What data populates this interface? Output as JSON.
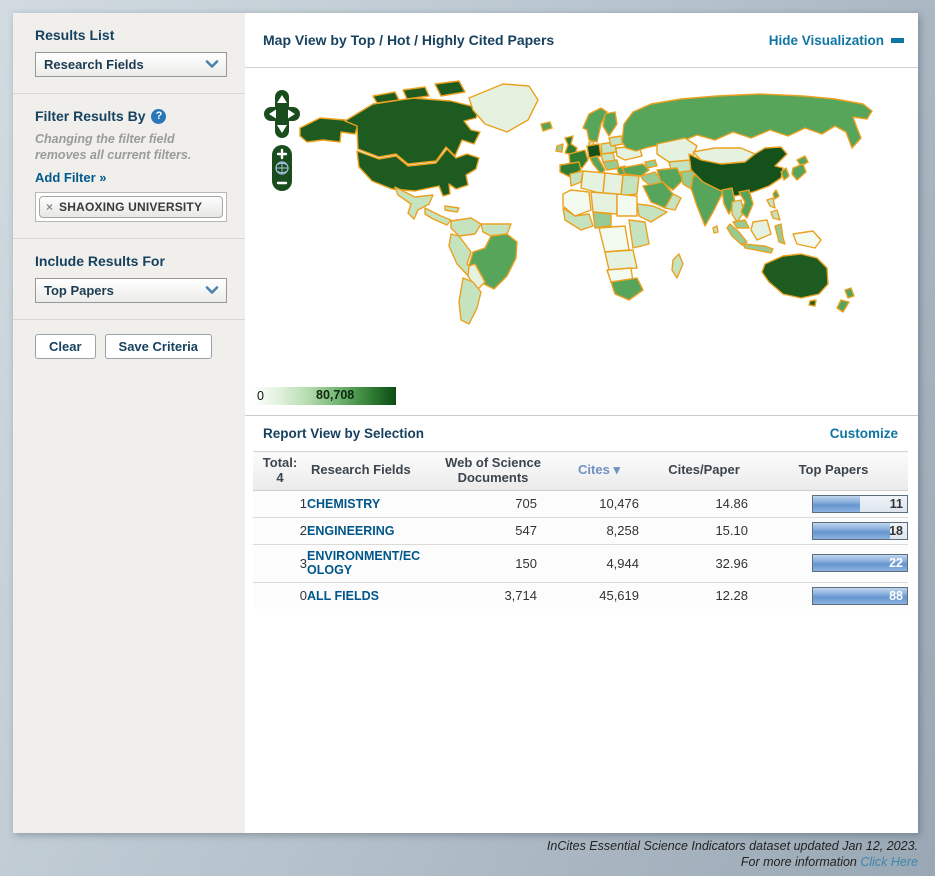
{
  "sidebar": {
    "results_list": {
      "label": "Results List",
      "value": "Research Fields"
    },
    "filter": {
      "label": "Filter Results By",
      "help_icon": "?",
      "note": "Changing the filter field removes all current filters.",
      "add_filter_link": "Add Filter »",
      "tag_remove_icon": "×",
      "tag": "SHAOXING UNIVERSITY"
    },
    "include": {
      "label": "Include Results For",
      "value": "Top Papers"
    },
    "buttons": {
      "clear": "Clear",
      "save": "Save Criteria"
    }
  },
  "map_section": {
    "title": "Map View by Top / Hot / Highly Cited Papers",
    "hide_link": "Hide Visualization",
    "controls": {
      "zoom_in": "+",
      "zoom_out": "−"
    },
    "legend": {
      "min": "0",
      "max": "80,708"
    },
    "palette": {
      "darkest": "#14511B",
      "dark": "#1D5B20",
      "mdark": "#2E7D32",
      "medium": "#56A55A",
      "mlight": "#98CA93",
      "light": "#C6E3C0",
      "vlight": "#E4F2DF",
      "pale": "#F3FAF0",
      "border": "#EBA11F"
    },
    "countries": {
      "alaska": "dark",
      "canada": "dark",
      "canada-island-1": "dark",
      "canada-island-2": "dark",
      "canada-island-3": "dark",
      "greenland": "vlight",
      "usa": "dark",
      "mexico": "light",
      "central-america": "light",
      "cuba": "light",
      "colombia": "light",
      "venezuela": "light",
      "brazil": "medium",
      "peru": "light",
      "bolivia": "vlight",
      "argentina": "light",
      "iceland": "medium",
      "ireland": "mlight",
      "uk": "mdark",
      "norway-sweden": "medium",
      "finland": "medium",
      "denmark": "light",
      "germany": "darkest",
      "poland": "light",
      "france": "mdark",
      "spain": "mdark",
      "italy": "medium",
      "east-europe": "light",
      "balkans": "mlight",
      "greece": "medium",
      "ukraine": "vlight",
      "baltics": "light",
      "russia": "medium",
      "kazakhstan": "vlight",
      "central-asia": "light",
      "caucasus": "mlight",
      "turkey": "medium",
      "syria-iraq": "mlight",
      "iran": "medium",
      "afghan-pakistan": "mlight",
      "saudi-arabia": "medium",
      "yemen-oman": "light",
      "morocco": "light",
      "algeria": "vlight",
      "libya": "vlight",
      "egypt": "light",
      "mali-mauritania": "pale",
      "niger-chad": "vlight",
      "sudan": "pale",
      "west-africa": "light",
      "nigeria": "mlight",
      "ethiopia-horn": "light",
      "congo": "pale",
      "east-africa": "light",
      "angola-zambia": "vlight",
      "namibia-botswana": "pale",
      "south-africa": "medium",
      "madagascar": "light",
      "india": "medium",
      "sri-lanka": "light",
      "mongolia": "vlight",
      "china": "darkest",
      "korea": "medium",
      "japan-north": "medium",
      "japan-south": "medium",
      "taiwan": "medium",
      "myanmar": "medium",
      "thailand": "light",
      "vietnam": "medium",
      "philippines-north": "light",
      "philippines-south": "light",
      "malaysia": "mlight",
      "sumatra": "mlight",
      "borneo": "vlight",
      "java": "mlight",
      "sulawesi": "mlight",
      "new-guinea": "pale",
      "australia": "dark",
      "tasmania": "dark",
      "nz-north": "medium",
      "nz-south": "medium"
    }
  },
  "report": {
    "title": "Report View by Selection",
    "customize_link": "Customize",
    "columns": {
      "total_line1": "Total:",
      "total_line2": "4",
      "field": "Research Fields",
      "wos": "Web of Science Documents",
      "cites": "Cites",
      "sort_indicator": "▾",
      "cpp": "Cites/Paper",
      "top": "Top Papers"
    },
    "rows": [
      {
        "rank": "1",
        "field": "CHEMISTRY",
        "wos_docs": "705",
        "cites": "10,476",
        "cites_per_paper": "14.86",
        "top_papers": "11",
        "bar_pct": 50
      },
      {
        "rank": "2",
        "field": "ENGINEERING",
        "wos_docs": "547",
        "cites": "8,258",
        "cites_per_paper": "15.10",
        "top_papers": "18",
        "bar_pct": 82
      },
      {
        "rank": "3",
        "field": "ENVIRONMENT/ECOLOGY",
        "wos_docs": "150",
        "cites": "4,944",
        "cites_per_paper": "32.96",
        "top_papers": "22",
        "bar_pct": 100
      },
      {
        "rank": "0",
        "field": "ALL FIELDS",
        "wos_docs": "3,714",
        "cites": "45,619",
        "cites_per_paper": "12.28",
        "top_papers": "88",
        "bar_pct": 100
      }
    ]
  },
  "footer": {
    "line1": "InCites Essential Science Indicators dataset updated Jan 12, 2023.",
    "line2_prefix": "For more information ",
    "link": "Click Here"
  }
}
